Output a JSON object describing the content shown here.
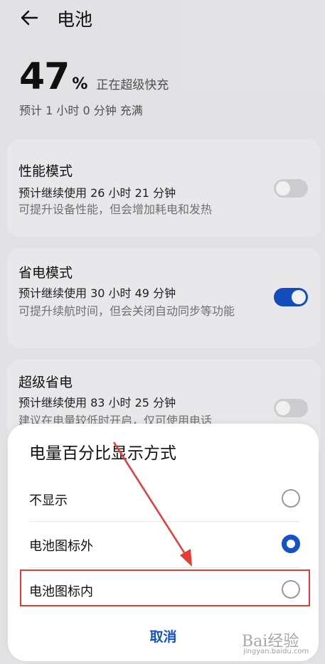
{
  "header": {
    "title": "电池",
    "back_icon": "back-arrow-icon"
  },
  "battery": {
    "percent": "47",
    "percent_sign": "%",
    "status": "正在超级快充",
    "eta": "预计 1 小时 0 分钟 充满"
  },
  "modes": [
    {
      "title": "性能模式",
      "estimate": "预计继续使用 26 小时 21 分钟",
      "desc": "可提升设备性能，但会增加耗电和发热",
      "enabled": false
    },
    {
      "title": "省电模式",
      "estimate": "预计继续使用 30 小时 49 分钟",
      "desc": "可提升续航时间，但会关闭自动同步等功能",
      "enabled": true
    },
    {
      "title": "超级省电",
      "estimate": "预计继续使用 83 小时 25 分钟",
      "desc": "建议在电量较低时开启，仅可使用电话",
      "enabled": false
    }
  ],
  "dialog": {
    "title": "电量百分比显示方式",
    "options": [
      {
        "label": "不显示",
        "selected": false
      },
      {
        "label": "电池图标外",
        "selected": true
      },
      {
        "label": "电池图标内",
        "selected": false
      }
    ],
    "cancel_label": "取消"
  },
  "colors": {
    "accent": "#1352c9",
    "annotation": "#e63b35"
  },
  "watermark": {
    "logo": "Bai经验",
    "site": "jingyan.baidu.com"
  }
}
